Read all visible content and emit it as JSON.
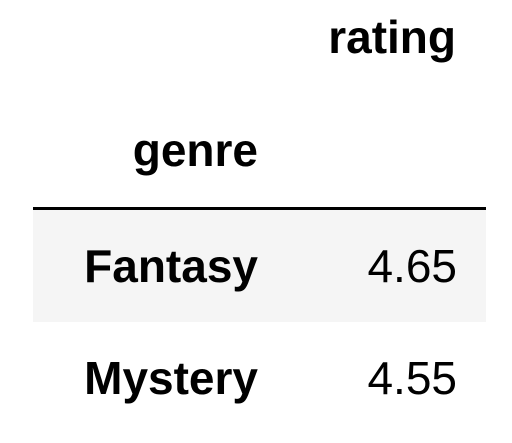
{
  "table": {
    "columns": [
      "rating"
    ],
    "index_name": "genre",
    "rows": [
      {
        "genre": "Fantasy",
        "rating": "4.65"
      },
      {
        "genre": "Mystery",
        "rating": "4.55"
      }
    ]
  },
  "colors": {
    "stripe": "#f5f5f5",
    "rule": "#000000",
    "text": "#000000"
  }
}
